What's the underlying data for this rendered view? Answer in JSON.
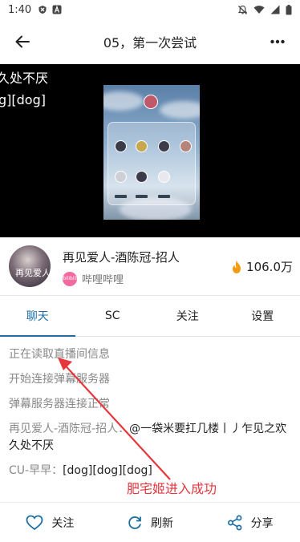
{
  "status_bar": {
    "time": "1:40"
  },
  "app_bar": {
    "title": "05，第一次尝试"
  },
  "video": {
    "danmaku": [
      "久处不厌",
      "g][dog]"
    ]
  },
  "streamer": {
    "name": "再见爱人-酒陈冠-招人",
    "platform": "哔哩哔哩",
    "platform_logo_text": "bilibili",
    "popularity": "106.0万",
    "avatar_caption": "再见爱人"
  },
  "tabs": [
    "聊天",
    "SC",
    "关注",
    "设置"
  ],
  "chat": {
    "system_messages": [
      "正在读取直播间信息",
      "开始连接弹幕服务器",
      "弹幕服务器连接正常"
    ],
    "user_messages": [
      {
        "user": "再见爱人-酒陈冠-招人：",
        "text": "@一袋米要扛几楼丨丿乍见之欢 久处不厌"
      },
      {
        "user": "CU-早早：",
        "text": "[dog][dog][dog]"
      }
    ]
  },
  "annotation": "肥宅姬进入成功",
  "bottom_bar": {
    "follow": "关注",
    "refresh": "刷新",
    "share": "分享"
  },
  "colors": {
    "accent": "#1f6fa3",
    "annotation": "#e8363d",
    "heat": "#f39c12"
  }
}
